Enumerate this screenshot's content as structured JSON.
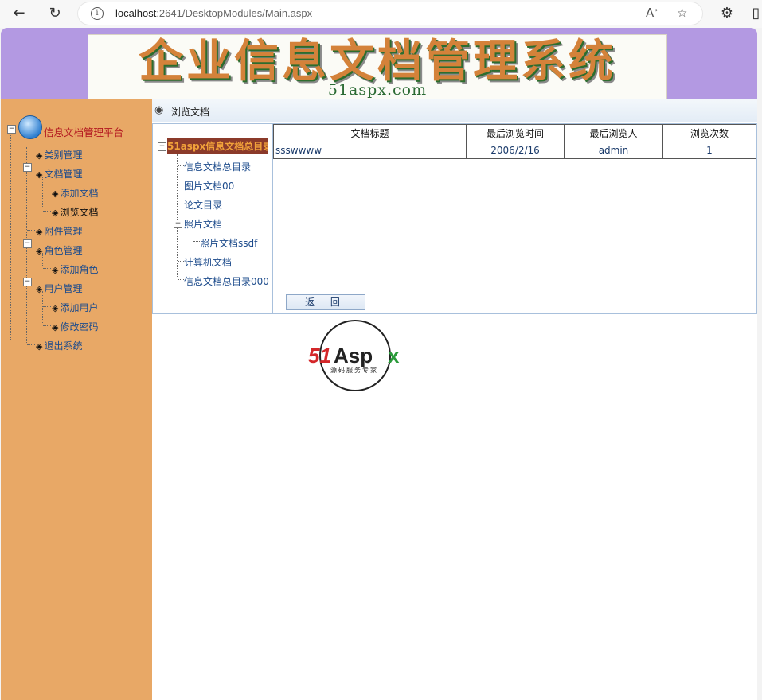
{
  "browser": {
    "url_host": "localhost",
    "url_rest": ":2641/DesktopModules/Main.aspx",
    "read_aloud_icon": "read-aloud-icon",
    "favorite_icon": "star-icon",
    "extensions_icon": "puzzle-icon"
  },
  "header": {
    "title": "企业信息文档管理系统",
    "subtitle": "51aspx.com"
  },
  "sidebar": {
    "root": "信息文档管理平台",
    "items": [
      {
        "label": "类别管理"
      },
      {
        "label": "文档管理"
      },
      {
        "label": "添加文档"
      },
      {
        "label": "浏览文档"
      },
      {
        "label": "附件管理"
      },
      {
        "label": "角色管理"
      },
      {
        "label": "添加角色"
      },
      {
        "label": "用户管理"
      },
      {
        "label": "添加用户"
      },
      {
        "label": "修改密码"
      },
      {
        "label": "退出系统"
      }
    ]
  },
  "content": {
    "title": "浏览文档",
    "doc_tree": {
      "root": "51aspx信息文档总目录",
      "items": [
        {
          "label": "信息文档总目录"
        },
        {
          "label": "图片文档00"
        },
        {
          "label": "论文目录"
        },
        {
          "label": "照片文档"
        },
        {
          "label": "照片文档ssdf"
        },
        {
          "label": "计算机文档"
        },
        {
          "label": "信息文档总目录000"
        }
      ]
    },
    "table": {
      "columns": [
        "文档标题",
        "最后浏览时间",
        "最后浏览人",
        "浏览次数"
      ],
      "rows": [
        [
          "ssswwww",
          "2006/2/16",
          "admin",
          "1"
        ]
      ]
    },
    "back_button": "返 回"
  },
  "brand": {
    "part1": "51",
    "part2": "Asp",
    "part3": "x",
    "tagline": "源码服务专家"
  }
}
